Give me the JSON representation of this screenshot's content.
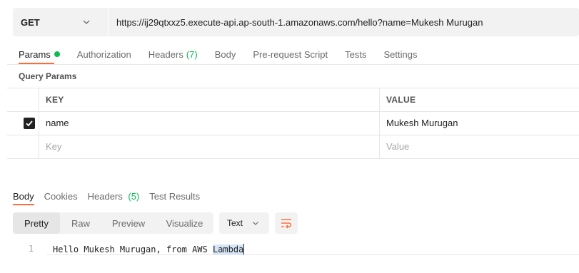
{
  "request": {
    "method": "GET",
    "url": "https://ij29qtxxz5.execute-api.ap-south-1.amazonaws.com/hello?name=Mukesh Murugan"
  },
  "request_tabs": [
    {
      "label": "Params",
      "active": true,
      "has_dot": true
    },
    {
      "label": "Authorization"
    },
    {
      "label": "Headers",
      "count": "(7)"
    },
    {
      "label": "Body"
    },
    {
      "label": "Pre-request Script"
    },
    {
      "label": "Tests"
    },
    {
      "label": "Settings"
    }
  ],
  "query_params": {
    "title": "Query Params",
    "columns": {
      "key": "KEY",
      "value": "VALUE"
    },
    "rows": [
      {
        "key": "name",
        "value": "Mukesh Murugan",
        "checked": true
      }
    ],
    "placeholder": {
      "key": "Key",
      "value": "Value"
    }
  },
  "response_tabs": [
    {
      "label": "Body",
      "active": true
    },
    {
      "label": "Cookies"
    },
    {
      "label": "Headers",
      "count": "(5)"
    },
    {
      "label": "Test Results"
    }
  ],
  "response_view": {
    "modes": [
      "Pretty",
      "Raw",
      "Preview",
      "Visualize"
    ],
    "active_mode": "Pretty",
    "format": "Text"
  },
  "response_body": {
    "line_number": "1",
    "text_plain": "Hello Mukesh Murugan, from AWS ",
    "text_selected": "Lambda"
  },
  "colors": {
    "accent": "#ff6c37",
    "active_dot": "#0cbb52"
  }
}
